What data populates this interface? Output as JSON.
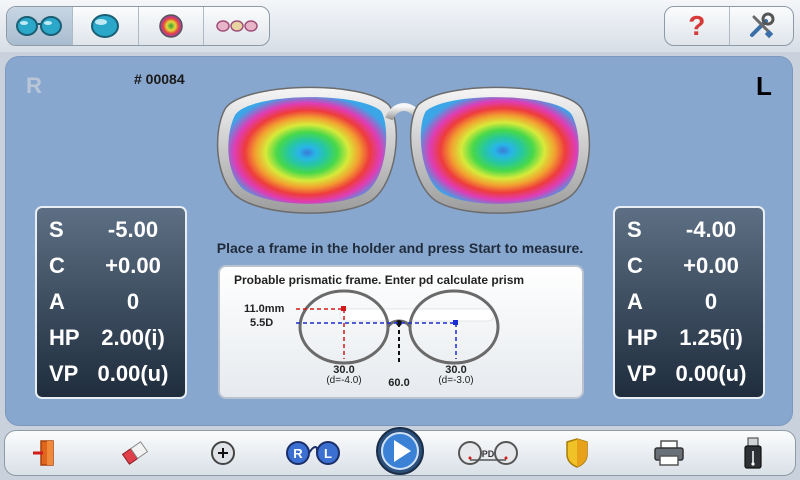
{
  "toolbar": {
    "modes": [
      {
        "icon": "dual-lens-icon",
        "active": true
      },
      {
        "icon": "single-lens-icon",
        "active": false
      },
      {
        "icon": "color-map-icon",
        "active": false
      },
      {
        "icon": "multi-lens-icon",
        "active": false
      }
    ],
    "help_icon": "help-icon",
    "help_glyph": "?",
    "settings_icon": "tools-icon"
  },
  "main": {
    "side_right": "R",
    "side_left": "L",
    "job_number": "# 00084",
    "instruction": "Place a frame in the holder and press Start to measure."
  },
  "right_lens": {
    "rows": [
      {
        "key": "S",
        "value": "-5.00"
      },
      {
        "key": "C",
        "value": "+0.00"
      },
      {
        "key": "A",
        "value": "0"
      },
      {
        "key": "HP",
        "value": "2.00(i)"
      },
      {
        "key": "VP",
        "value": "0.00(u)"
      }
    ]
  },
  "left_lens": {
    "rows": [
      {
        "key": "S",
        "value": "-4.00"
      },
      {
        "key": "C",
        "value": "+0.00"
      },
      {
        "key": "A",
        "value": "0"
      },
      {
        "key": "HP",
        "value": "1.25(i)"
      },
      {
        "key": "VP",
        "value": "0.00(u)"
      }
    ]
  },
  "prism": {
    "message": "Probable prismatic frame. Enter pd calculate prism",
    "height_label": "11.0mm",
    "prism_label": "5.5D",
    "right_value": "30.0",
    "right_decentration": "(d=-4.0)",
    "left_value": "30.0",
    "left_decentration": "(d=-3.0)",
    "pd_value": "60.0"
  },
  "bottom": {
    "buttons": [
      {
        "icon": "exit-door-icon"
      },
      {
        "icon": "eraser-icon"
      },
      {
        "icon": "add-icon"
      },
      {
        "icon": "right-left-switch-icon",
        "r": "R",
        "l": "L"
      },
      {
        "icon": "play-start-icon"
      },
      {
        "icon": "pd-measure-icon",
        "label": "PD"
      },
      {
        "icon": "shield-badge-icon"
      },
      {
        "icon": "printer-icon"
      },
      {
        "icon": "usb-drive-icon"
      }
    ]
  },
  "colors": {
    "main_bg": "#88a7cf",
    "panel_dark": "#1f2d3d",
    "red_line": "#d11a1a",
    "blue_line": "#1a2cd1"
  }
}
